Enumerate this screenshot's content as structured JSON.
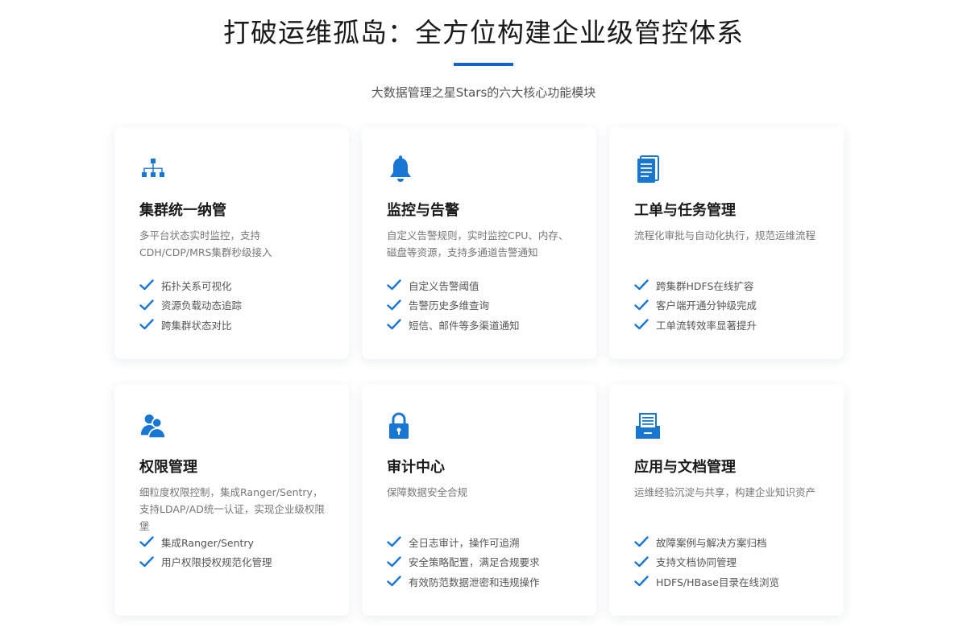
{
  "header": {
    "title": "打破运维孤岛：全方位构建企业级管控体系",
    "subtitle": "大数据管理之星Stars的六大核心功能模块"
  },
  "colors": {
    "accent": "#1565c0",
    "icon": "#1976d2"
  },
  "cards": [
    {
      "icon": "hierarchy-icon",
      "title": "集群统一纳管",
      "desc": "多平台状态实时监控，支持CDH/CDP/MRS集群秒级接入",
      "features": [
        "拓扑关系可视化",
        "资源负载动态追踪",
        "跨集群状态对比"
      ]
    },
    {
      "icon": "bell-icon",
      "title": "监控与告警",
      "desc": "自定义告警规则，实时监控CPU、内存、磁盘等资源，支持多通道告警通知",
      "features": [
        "自定义告警阈值",
        "告警历史多维查询",
        "短信、邮件等多渠道通知"
      ]
    },
    {
      "icon": "document-icon",
      "title": "工单与任务管理",
      "desc": "流程化审批与自动化执行，规范运维流程",
      "features": [
        "跨集群HDFS在线扩容",
        "客户端开通分钟级完成",
        "工单流转效率显著提升"
      ]
    },
    {
      "icon": "users-icon",
      "title": "权限管理",
      "desc": "细粒度权限控制，集成Ranger/Sentry，支持LDAP/AD统一认证，实现企业级权限堡",
      "features": [
        "集成Ranger/Sentry",
        "用户权限授权规范化管理"
      ]
    },
    {
      "icon": "lock-icon",
      "title": "审计中心",
      "desc": "保障数据安全合规",
      "features": [
        "全日志审计，操作可追溯",
        "安全策略配置，满足合规要求",
        "有效防范数据泄密和违规操作"
      ]
    },
    {
      "icon": "archive-icon",
      "title": "应用与文档管理",
      "desc": "运维经验沉淀与共享，构建企业知识资产",
      "features": [
        "故障案例与解决方案归档",
        "支持文档协同管理",
        "HDFS/HBase目录在线浏览"
      ]
    }
  ]
}
